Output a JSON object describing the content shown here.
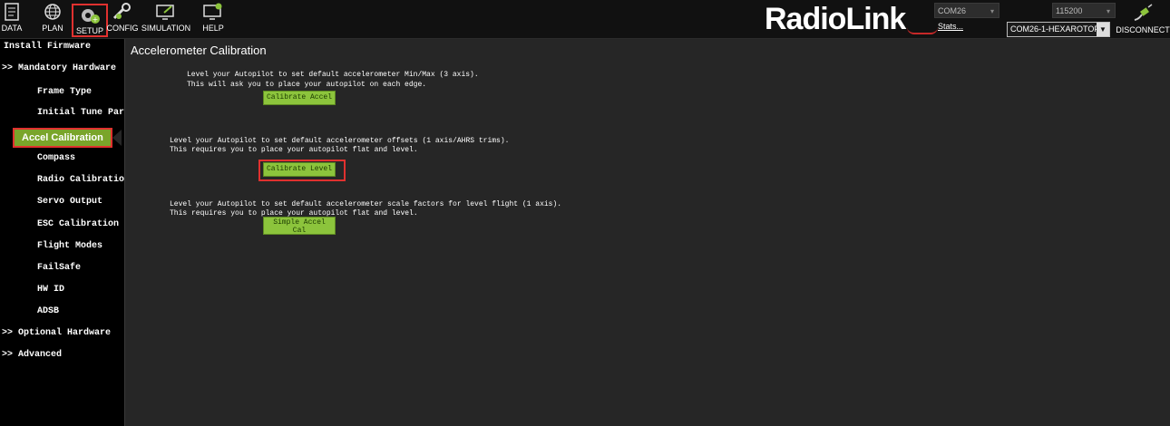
{
  "toolbar": {
    "buttons": [
      {
        "label": "DATA",
        "icon": "data-icon"
      },
      {
        "label": "PLAN",
        "icon": "plan-globe-icon"
      },
      {
        "label": "SETUP",
        "icon": "setup-gear-icon"
      },
      {
        "label": "CONFIG",
        "icon": "config-wrench-icon"
      },
      {
        "label": "SIMULATION",
        "icon": "simulation-monitor-icon"
      },
      {
        "label": "HELP",
        "icon": "help-monitor-icon"
      }
    ],
    "logo": "RadioLink",
    "port": "COM26",
    "baud": "115200",
    "stats": "Stats...",
    "link": "COM26-1-HEXAROTOF",
    "disconnect": "DISCONNECT",
    "highlight_color": "#e0312f"
  },
  "sidebar": {
    "items": [
      {
        "label": "Install Firmware"
      },
      {
        "label": ">> Mandatory Hardware"
      },
      {
        "label": "Frame Type"
      },
      {
        "label": "Initial Tune Par"
      },
      {
        "label": "Accel Calibration"
      },
      {
        "label": "Compass"
      },
      {
        "label": "Radio Calibratio"
      },
      {
        "label": "Servo Output"
      },
      {
        "label": "ESC Calibration"
      },
      {
        "label": "Flight Modes"
      },
      {
        "label": "FailSafe"
      },
      {
        "label": "HW ID"
      },
      {
        "label": "ADSB"
      },
      {
        "label": ">> Optional Hardware"
      },
      {
        "label": ">> Advanced"
      }
    ],
    "active_color": "#7aa52a"
  },
  "main": {
    "title": "Accelerometer Calibration",
    "section1": {
      "line1": "Level your Autopilot to set default accelerometer Min/Max (3 axis).",
      "line2": "This will ask you to place your autopilot on each edge.",
      "button": "Calibrate Accel"
    },
    "section2": {
      "line1": "Level your Autopilot to set default accelerometer offsets (1 axis/AHRS trims).",
      "line2": "This requires you to place your autopilot flat and level.",
      "button": "Calibrate Level"
    },
    "section3": {
      "line1": "Level your Autopilot to set default accelerometer scale factors for level flight (1 axis).",
      "line2": "This requires you to place your autopilot flat and level.",
      "button_line1": "Simple Accel",
      "button_line2": "Cal"
    }
  }
}
